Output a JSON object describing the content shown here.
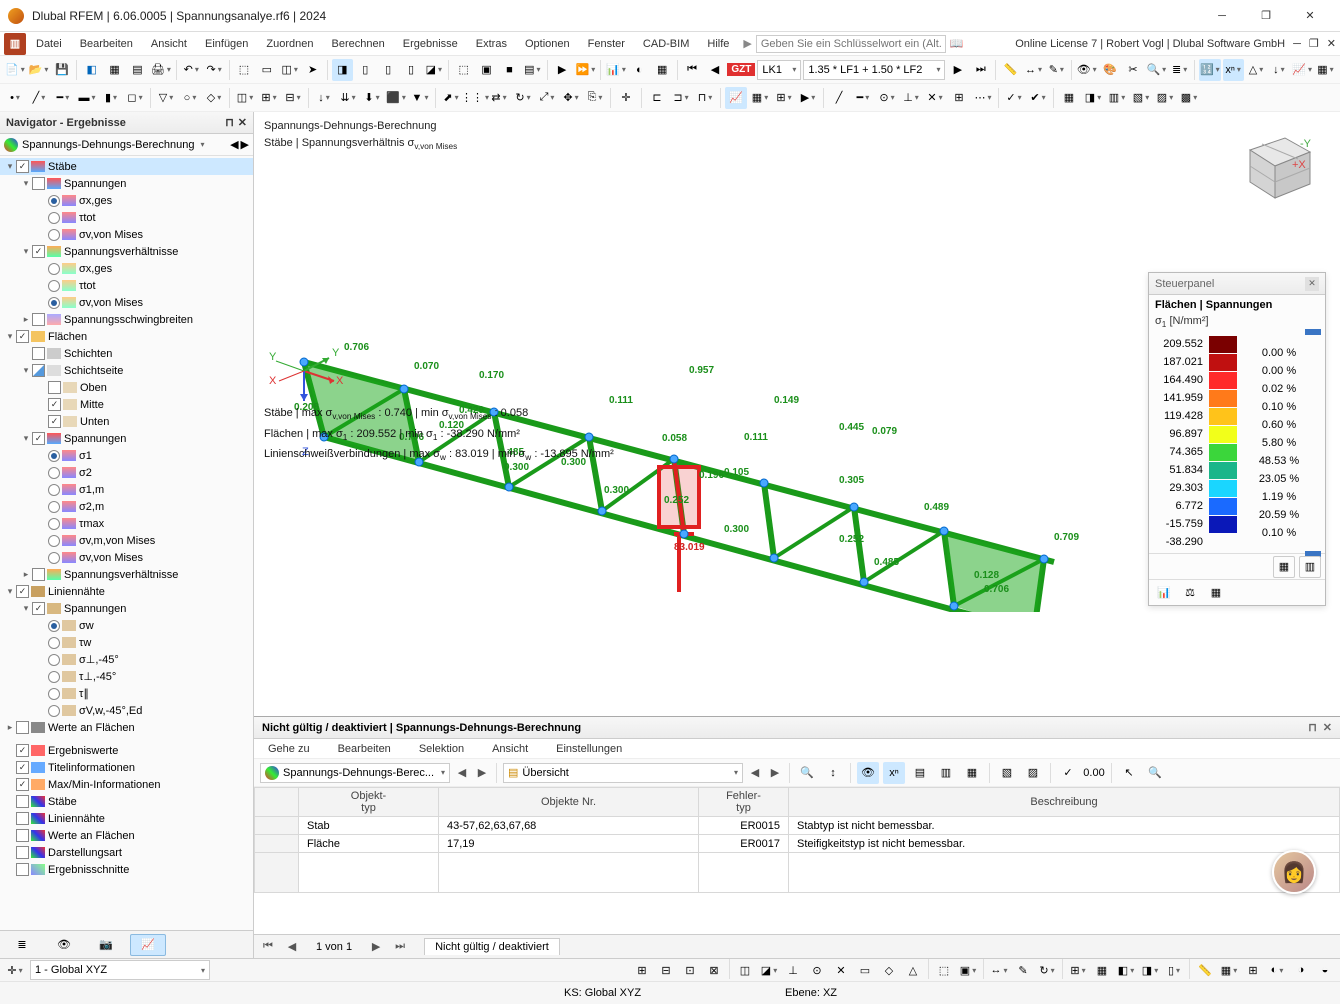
{
  "window": {
    "title": "Dlubal RFEM | 6.06.0005 | Spannungsanalye.rf6 | 2024",
    "license": "Online License 7 | Robert Vogl | Dlubal Software GmbH"
  },
  "menu": {
    "items": [
      "Datei",
      "Bearbeiten",
      "Ansicht",
      "Einfügen",
      "Zuordnen",
      "Berechnen",
      "Ergebnisse",
      "Extras",
      "Optionen",
      "Fenster",
      "CAD-BIM",
      "Hilfe"
    ],
    "search_placeholder": "Geben Sie ein Schlüsselwort ein (Alt..."
  },
  "lk": {
    "tag": "GZT",
    "combo": "LK1",
    "formula": "1.35 * LF1 + 1.50 * LF2"
  },
  "navigator": {
    "title": "Navigator - Ergebnisse",
    "selector": "Spannungs-Dehnungs-Berechnung",
    "tree": {
      "staebe": {
        "label": "Stäbe",
        "spannungen": {
          "label": "Spannungen",
          "opts": [
            "σx,ges",
            "τtot",
            "σv,von Mises"
          ],
          "selected": 0
        },
        "spannungsverh": {
          "label": "Spannungsverhältnisse",
          "opts": [
            "σx,ges",
            "τtot",
            "σv,von Mises"
          ],
          "selected": 2
        },
        "schwingbreiten": "Spannungsschwingbreiten"
      },
      "flaechen": {
        "label": "Flächen",
        "schichten": "Schichten",
        "schichtseite": {
          "label": "Schichtseite",
          "opts": [
            "Oben",
            "Mitte",
            "Unten"
          ]
        },
        "spannungen": {
          "label": "Spannungen",
          "opts": [
            "σ1",
            "σ2",
            "σ1,m",
            "σ2,m",
            "τmax",
            "σv,m,von Mises",
            "σv,von Mises"
          ],
          "selected": 0
        },
        "spannungsverh": "Spannungsverhältnisse"
      },
      "liniennaehte": {
        "label": "Liniennähte",
        "spannungen": {
          "label": "Spannungen",
          "opts": [
            "σw",
            "τw",
            "σ⊥,-45°",
            "τ⊥,-45°",
            "τ∥",
            "σV,w,-45°,Ed"
          ],
          "selected": 0
        }
      },
      "werte_flaechen": "Werte an Flächen",
      "ergebniswerte": "Ergebniswerte",
      "titelinfo": "Titelinformationen",
      "maxmin": "Max/Min-Informationen",
      "staebe2": "Stäbe",
      "liniennaehte2": "Liniennähte",
      "werte_flaechen2": "Werte an Flächen",
      "darstellungsart": "Darstellungsart",
      "ergebnisschnitte": "Ergebnisschnitte"
    }
  },
  "viewport": {
    "line1": "Spannungs-Dehnungs-Berechnung",
    "line2_a": "Stäbe | Spannungsverhältnis σ",
    "line2_b": "v,von Mises",
    "values": [
      "0.706",
      "0.070",
      "0.170",
      "0.111",
      "0.957",
      "0.149",
      "0.445",
      "0.706",
      "0.120",
      "0.208",
      "0.706",
      "0.300",
      "0.485",
      "0.429",
      "0.485",
      "0.300",
      "0.252",
      "0.300",
      "0.111",
      "0.196",
      "0.105",
      "0.489",
      "0.709",
      "0.300",
      "0.305",
      "0.252",
      "0.079",
      "0.128",
      "0.706",
      "83.019",
      "0.058"
    ],
    "result_lines": {
      "l1": "Stäbe | max σv,von Mises : 0.740 | min σv,von Mises : 0.058",
      "l2": "Flächen | max σ1 : 209.552 | min σ1 : -38.290 N/mm²",
      "l3": "Linienschweißverbindungen | max σw : 83.019 | min σw : -13.895 N/mm²"
    }
  },
  "steuer": {
    "title": "Steuerpanel",
    "heading": "Flächen | Spannungen",
    "sub": "σ1 [N/mm²]",
    "legend": [
      {
        "v": "209.552",
        "c": "#7a0000",
        "p": ""
      },
      {
        "v": "187.021",
        "c": "#c01010",
        "p": "0.00 %"
      },
      {
        "v": "164.490",
        "c": "#ff2a2a",
        "p": "0.00 %"
      },
      {
        "v": "141.959",
        "c": "#ff7a1a",
        "p": "0.02 %"
      },
      {
        "v": "119.428",
        "c": "#ffc31a",
        "p": "0.10 %"
      },
      {
        "v": "96.897",
        "c": "#f2ff1a",
        "p": "0.60 %"
      },
      {
        "v": "74.365",
        "c": "#3bd63b",
        "p": "5.80 %"
      },
      {
        "v": "51.834",
        "c": "#1ab68a",
        "p": "48.53 %"
      },
      {
        "v": "29.303",
        "c": "#1ad6ff",
        "p": "23.05 %"
      },
      {
        "v": "6.772",
        "c": "#1a6aff",
        "p": "1.19 %"
      },
      {
        "v": "-15.759",
        "c": "#0a18b8",
        "p": "20.59 %"
      },
      {
        "v": "-38.290",
        "c": "#030640",
        "p": "0.10 %"
      }
    ]
  },
  "bottom_panel": {
    "title": "Nicht gültig / deaktiviert | Spannungs-Dehnungs-Berechnung",
    "menu": [
      "Gehe zu",
      "Bearbeiten",
      "Selektion",
      "Ansicht",
      "Einstellungen"
    ],
    "dropdown1": "Spannungs-Dehnungs-Berec...",
    "dropdown2": "Übersicht",
    "columns": [
      "Objekt-\ntyp",
      "Objekte Nr.",
      "Fehler-\ntyp",
      "Beschreibung"
    ],
    "rows": [
      {
        "typ": "Stab",
        "nr": "43-57,62,63,67,68",
        "err": "ER0015",
        "desc": "Stabtyp ist nicht bemessbar."
      },
      {
        "typ": "Fläche",
        "nr": "17,19",
        "err": "ER0017",
        "desc": "Steifigkeitstyp ist nicht bemessbar."
      }
    ],
    "pager": "1 von 1",
    "tab": "Nicht gültig / deaktiviert"
  },
  "status": {
    "coordsys": "1 - Global XYZ",
    "ks": "KS: Global XYZ",
    "ebene": "Ebene: XZ"
  }
}
